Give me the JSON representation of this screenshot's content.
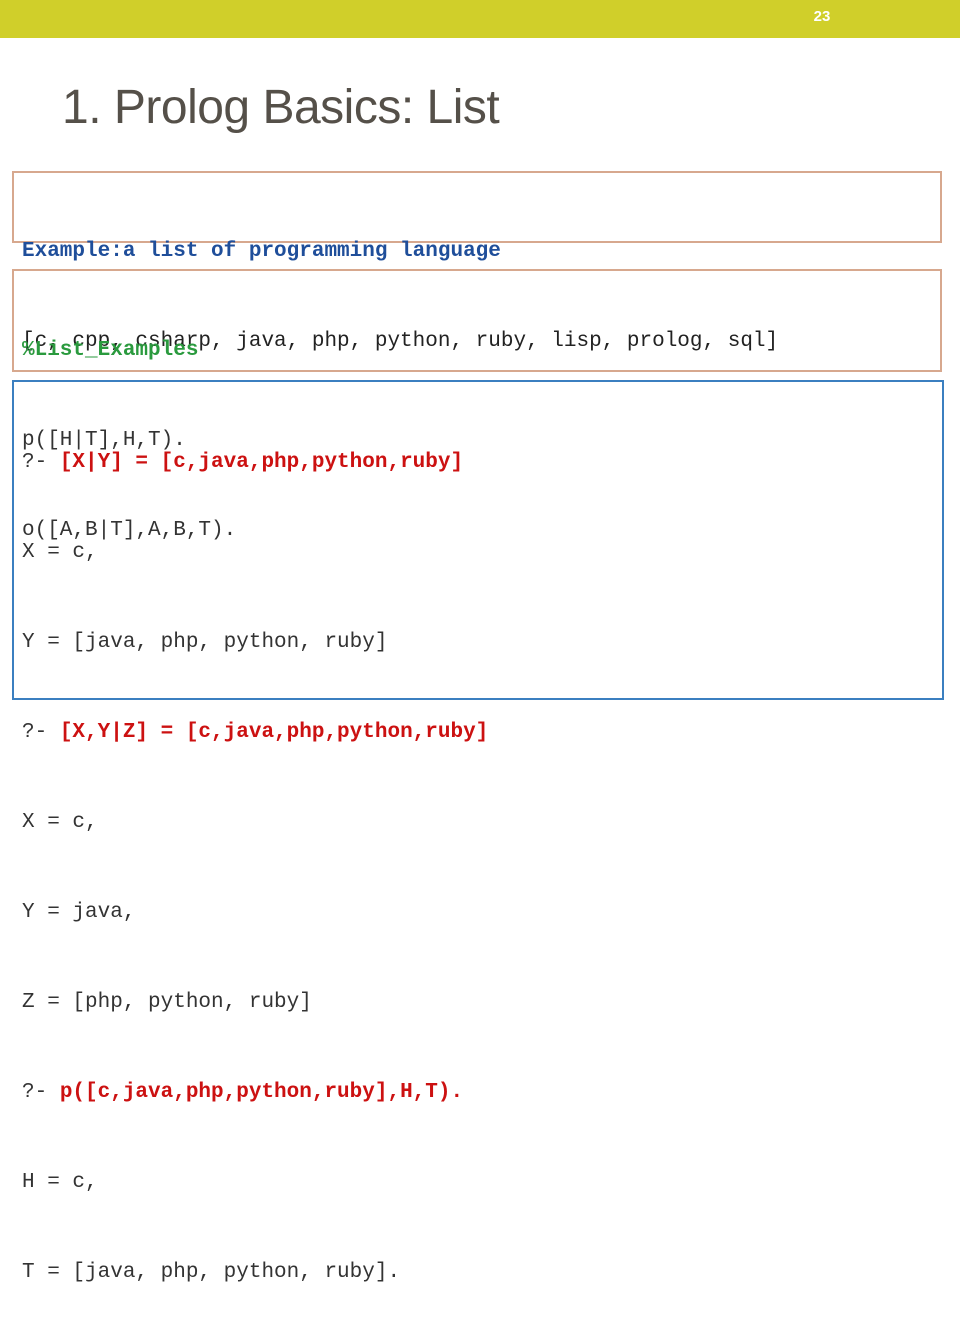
{
  "slide": {
    "page_number": "23",
    "title": "1. Prolog Basics: List"
  },
  "box1": {
    "heading": "Example:a list of programming language",
    "list": "[c, cpp, csharp, java, php, python, ruby, lisp, prolog, sql]"
  },
  "box2": {
    "comment": "%List_Examples",
    "rule1": "p([H|T],H,T).",
    "rule2": "o([A,B|T],A,B,T)."
  },
  "box3": {
    "prompt": "?- ",
    "query1": "[X|Y] = [c,java,php,python,ruby]",
    "q1_line1": "X = c,",
    "q1_line2": "Y = [java, php, python, ruby]",
    "query2": "[X,Y|Z] = [c,java,php,python,ruby]",
    "q2_line1": "X = c,",
    "q2_line2": "Y = java,",
    "q2_line3": "Z = [php, python, ruby]",
    "query3": "p([c,java,php,python,ruby],H,T).",
    "q3_line1": "H = c,",
    "q3_line2": "T = [java, php, python, ruby]."
  }
}
